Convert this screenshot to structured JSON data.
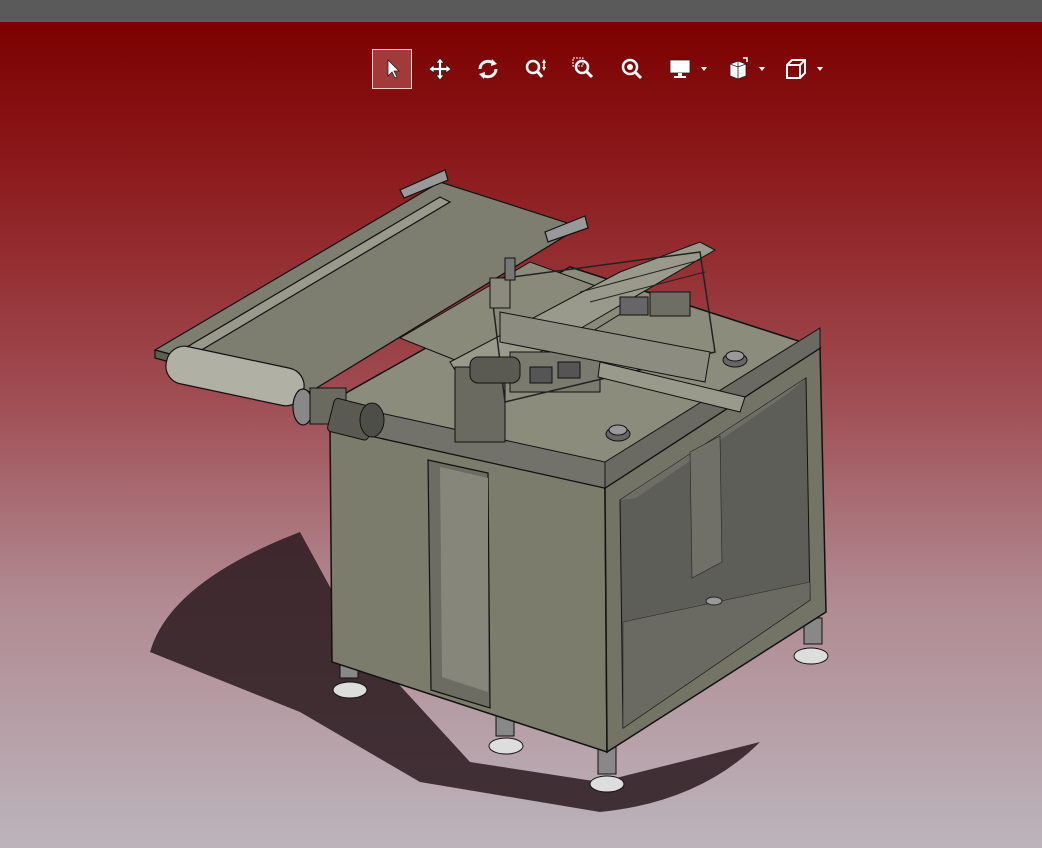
{
  "toolbar": {
    "buttons": [
      {
        "id": "select",
        "icon": "cursor-arrow-icon",
        "active": true
      },
      {
        "id": "pan",
        "icon": "move-arrows-icon",
        "active": false
      },
      {
        "id": "rotate",
        "icon": "rotate-icon",
        "active": false
      },
      {
        "id": "zoom-in-out",
        "icon": "zoom-in-out-icon",
        "active": false
      },
      {
        "id": "zoom-area",
        "icon": "zoom-area-icon",
        "active": false
      },
      {
        "id": "fit-all",
        "icon": "fit-all-icon",
        "active": false
      },
      {
        "id": "display-mode",
        "icon": "monitor-icon",
        "dropdown": true
      },
      {
        "id": "view-selector",
        "icon": "view-cube-icon",
        "dropdown": true
      },
      {
        "id": "render-style",
        "icon": "box-icon",
        "dropdown": true
      }
    ]
  },
  "colors": {
    "titlebar": "#5a5a5a",
    "background_top": "#7c0000",
    "background_bottom": "#bcb4bc",
    "model_body": "#7a7a6a",
    "active_button": "#a23a3a"
  }
}
